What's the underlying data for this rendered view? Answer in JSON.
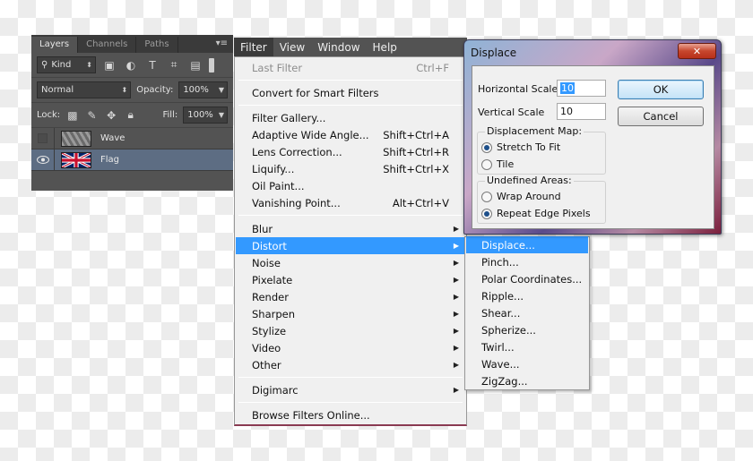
{
  "layers_panel": {
    "tabs": [
      "Layers",
      "Channels",
      "Paths"
    ],
    "menu_icon": "panel-menu-icon",
    "filter_kind": "Kind",
    "blend_mode": "Normal",
    "opacity_label": "Opacity:",
    "opacity_value": "100%",
    "lock_label": "Lock:",
    "fill_label": "Fill:",
    "fill_value": "100%",
    "layers": [
      {
        "name": "Wave",
        "visible": false
      },
      {
        "name": "Flag",
        "visible": true
      }
    ]
  },
  "menubar": {
    "items": [
      "Filter",
      "View",
      "Window",
      "Help"
    ]
  },
  "filter_menu": {
    "last_filter": {
      "label": "Last Filter",
      "shortcut": "Ctrl+F"
    },
    "convert": "Convert for Smart Filters",
    "filter_gallery": "Filter Gallery...",
    "adaptive": {
      "label": "Adaptive Wide Angle...",
      "shortcut": "Shift+Ctrl+A"
    },
    "lens": {
      "label": "Lens Correction...",
      "shortcut": "Shift+Ctrl+R"
    },
    "liquify": {
      "label": "Liquify...",
      "shortcut": "Shift+Ctrl+X"
    },
    "oil": "Oil Paint...",
    "vanishing": {
      "label": "Vanishing Point...",
      "shortcut": "Alt+Ctrl+V"
    },
    "groups": [
      "Blur",
      "Distort",
      "Noise",
      "Pixelate",
      "Render",
      "Sharpen",
      "Stylize",
      "Video",
      "Other"
    ],
    "digimarc": "Digimarc",
    "browse": "Browse Filters Online..."
  },
  "distort_submenu": {
    "items": [
      "Displace...",
      "Pinch...",
      "Polar Coordinates...",
      "Ripple...",
      "Shear...",
      "Spherize...",
      "Twirl...",
      "Wave...",
      "ZigZag..."
    ]
  },
  "displace_dialog": {
    "title": "Displace",
    "close_glyph": "✕",
    "horizontal_label": "Horizontal Scale",
    "horizontal_value": "10",
    "vertical_label": "Vertical Scale",
    "vertical_value": "10",
    "ok": "OK",
    "cancel": "Cancel",
    "map_group": "Displacement Map:",
    "stretch": "Stretch To Fit",
    "tile": "Tile",
    "undefined_group": "Undefined Areas:",
    "wrap": "Wrap Around",
    "repeat": "Repeat Edge Pixels"
  },
  "colors": {
    "highlight": "#3399ff",
    "panel_bg": "#535353",
    "menu_bg": "#f0f0f0",
    "close_red": "#c7462d"
  }
}
